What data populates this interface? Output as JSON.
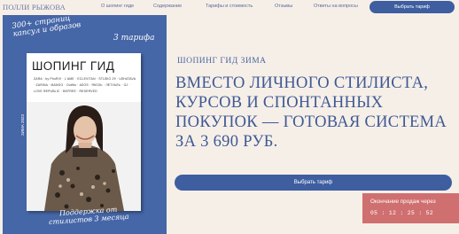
{
  "header": {
    "logo": "ПОЛЛИ РЫЖОВА",
    "nav": [
      "О шопинг гиде",
      "Содержание",
      "Тарифы и стоимость",
      "Отзывы",
      "Ответы на вопросы"
    ],
    "cta": "Выбрать тариф"
  },
  "card": {
    "handwritten_top": "300+ страниц капсул и образов",
    "handwritten_tariffs": "3 тарифа",
    "book_title": "ШОПИНГ ГИД",
    "brands": "ZARA · by PhoRIV · L'AME · ECLEVITAN · STUDIO 29 · USHATAVA · ZARINA · MANGO · Outfits · ASOS · ЯКОЗЬ · ЛЕТУАЛЬ · GJ · LOVE REPUBLIC · BEFREE · RESERVED",
    "spine": "ЗИМА 2023",
    "handwritten_bottom": "Поддержка от стилистов 3 месяца"
  },
  "main": {
    "subtitle": "ШОПИНГ ГИД ЗИМА",
    "headline": "ВМЕСТО ЛИЧНОГО СТИЛИСТА, КУРСОВ И СПОНТАННЫХ ПОКУПОК — ГОТОВАЯ СИСТЕМА ЗА 3 690 РУБ.",
    "cta": "Выбрать тариф"
  },
  "timer": {
    "label": "Окончание продаж через",
    "value": "05 : 12 : 25 : 52"
  },
  "colors": {
    "background": "#f6efe8",
    "accent": "#3e5ea0",
    "card": "#4566a7",
    "timer": "#d06f6f"
  }
}
